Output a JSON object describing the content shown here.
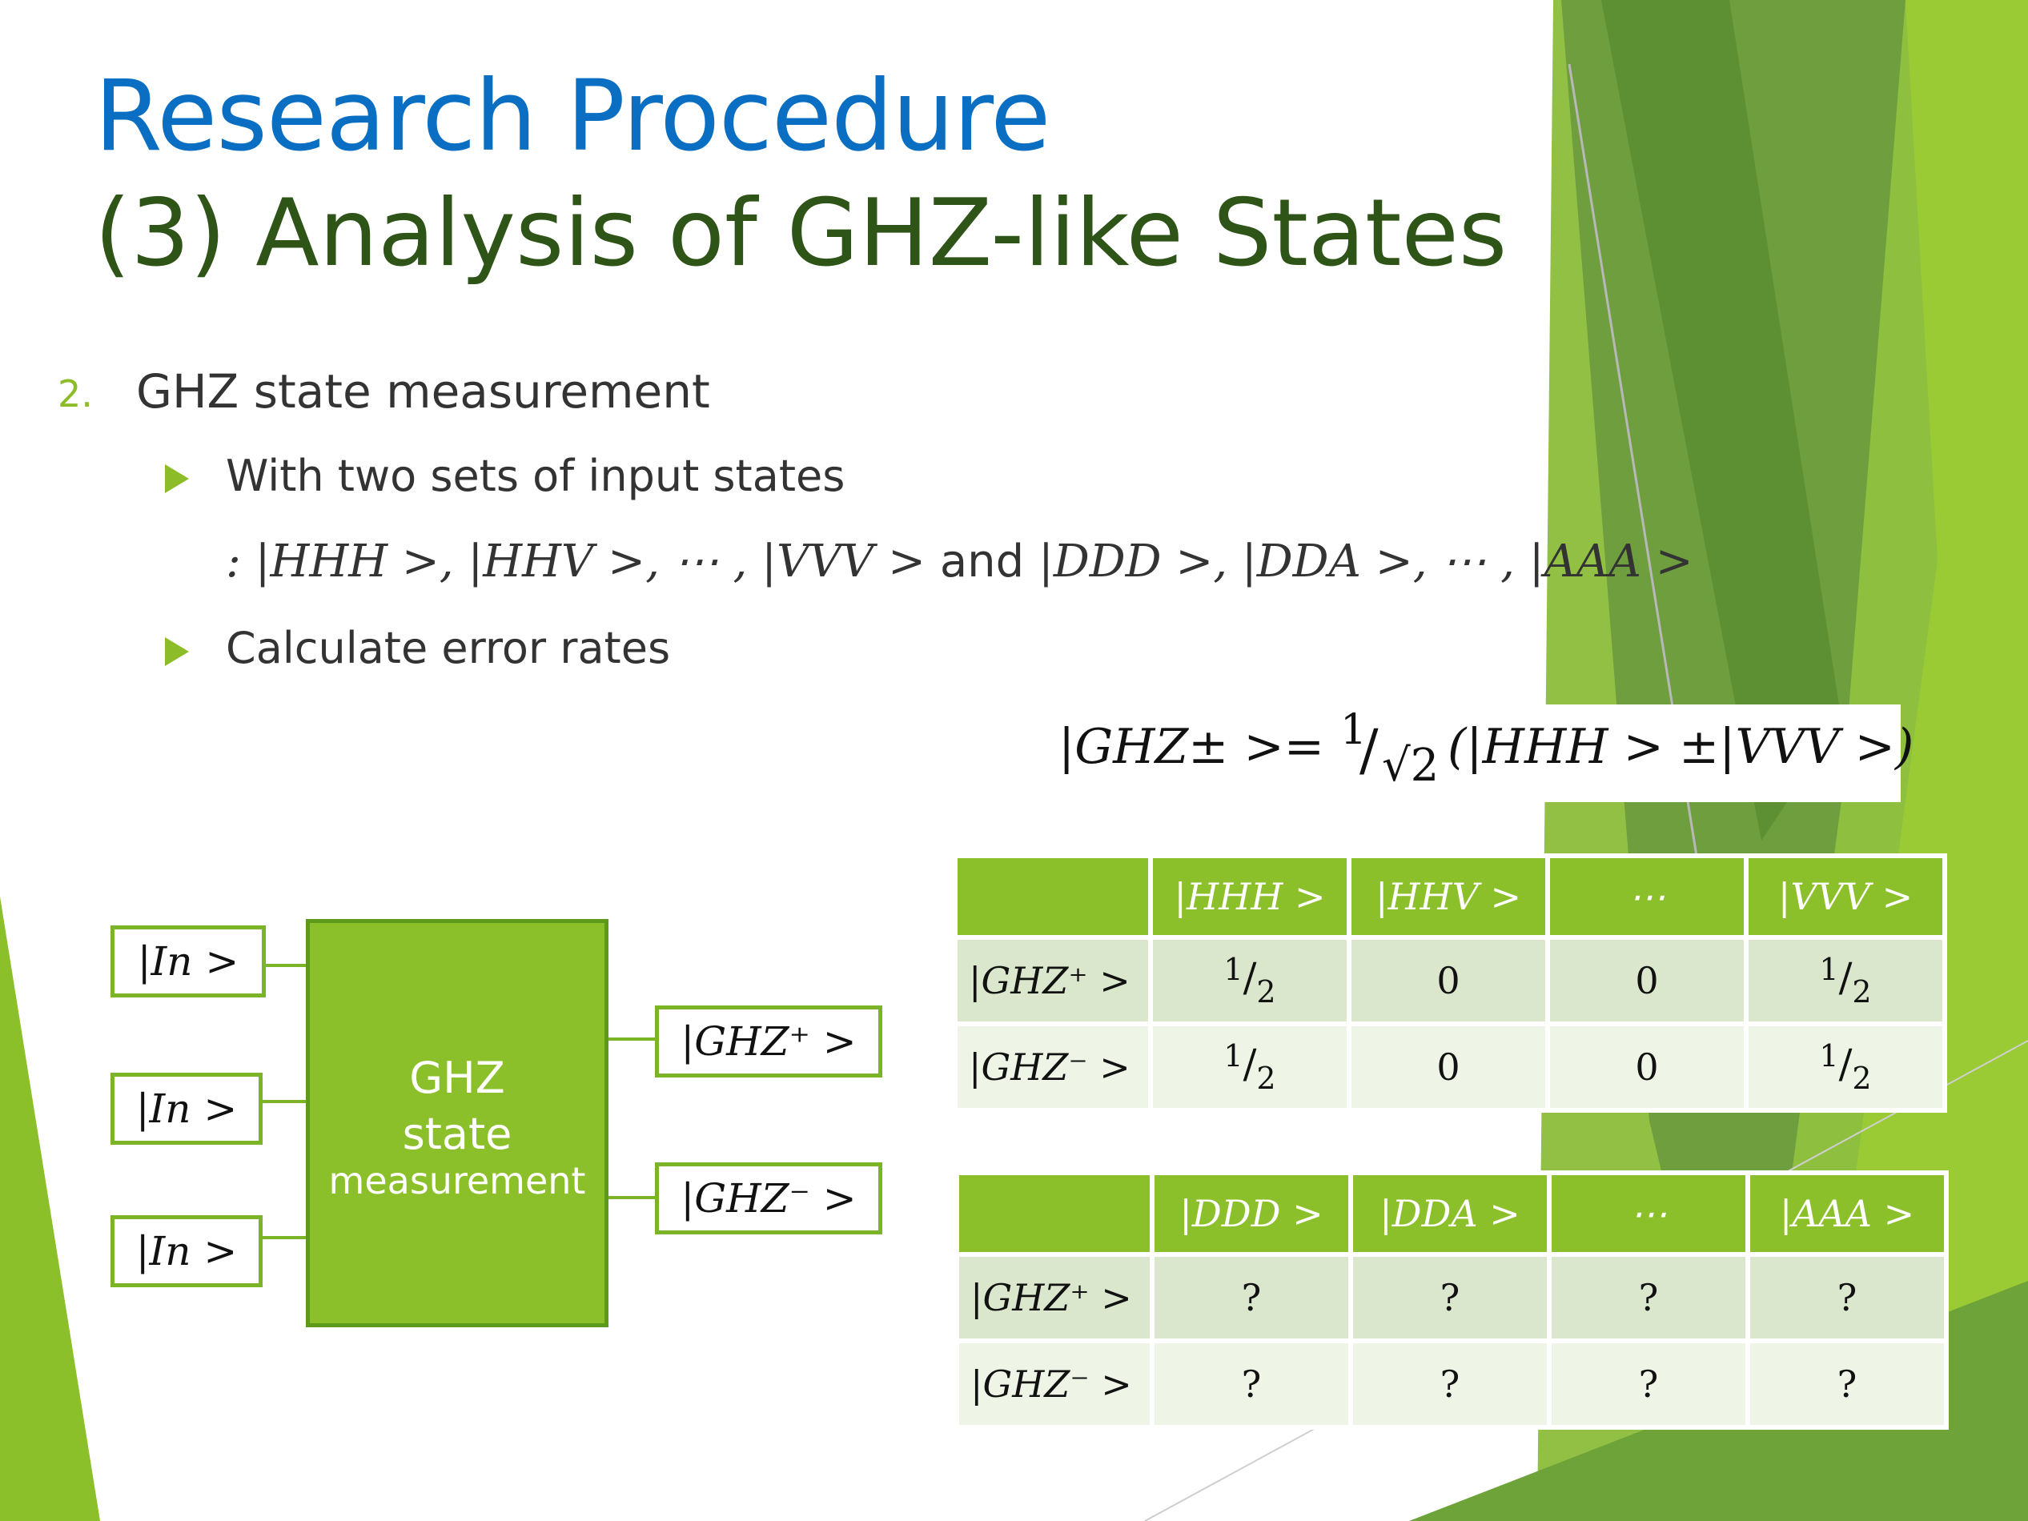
{
  "title": {
    "line1": "Research Procedure",
    "line2": "(3) Analysis of GHZ-like States"
  },
  "content": {
    "list_number": "2.",
    "item_title": "GHZ state measurement",
    "bullets": [
      {
        "text": "With two sets of input states"
      },
      {
        "text": "Calculate error rates"
      }
    ],
    "input_states_line": {
      "prefix": ": |HHH >, |HHV >, ⋯ , |VVV >",
      "connector": "and",
      "suffix": "|DDD >, |DDA >, ⋯ , |AAA >"
    }
  },
  "formula": {
    "lhs": "|GHZ± >=",
    "numerator": "1",
    "slash": "/",
    "denominator": "√2",
    "rhs": "(|HHH > ±|VVV >)"
  },
  "diagram": {
    "inputs": [
      "|In >",
      "|In >",
      "|In >"
    ],
    "box_lines": [
      "GHZ",
      "state",
      "measurement"
    ],
    "outputs": [
      "|GHZ⁺ >",
      "|GHZ⁻ >"
    ]
  },
  "table1": {
    "headers": [
      "",
      "|HHH >",
      "|HHV >",
      "⋯",
      "|VVV >"
    ],
    "rows": [
      {
        "label": "|GHZ⁺ >",
        "cells": [
          "1/2",
          "0",
          "0",
          "1/2"
        ]
      },
      {
        "label": "|GHZ⁻ >",
        "cells": [
          "1/2",
          "0",
          "0",
          "1/2"
        ]
      }
    ]
  },
  "table2": {
    "headers": [
      "",
      "|DDD >",
      "|DDA >",
      "⋯",
      "|AAA >"
    ],
    "rows": [
      {
        "label": "|GHZ⁺ >",
        "cells": [
          "?",
          "?",
          "?",
          "?"
        ]
      },
      {
        "label": "|GHZ⁻ >",
        "cells": [
          "?",
          "?",
          "?",
          "?"
        ]
      }
    ]
  },
  "colors": {
    "title_blue": "#0a6fc2",
    "title_green": "#2e5418",
    "accent_green": "#8cc02a",
    "row_light_1": "#dbe7cc",
    "row_light_2": "#eef4e6"
  }
}
